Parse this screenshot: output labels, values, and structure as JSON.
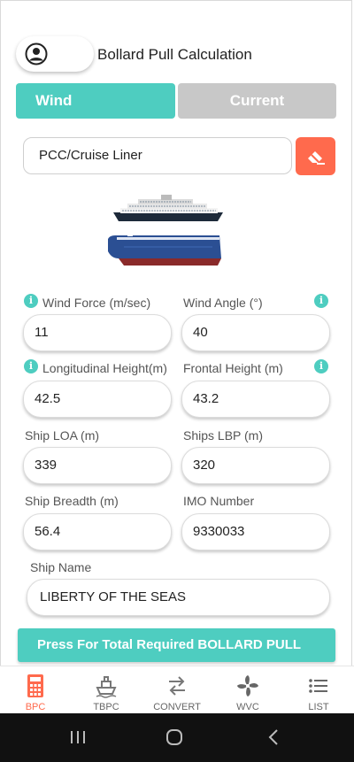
{
  "header": {
    "title": "Bollard Pull Calculation"
  },
  "tabs": [
    {
      "label": "Wind",
      "active": true
    },
    {
      "label": "Current",
      "active": false
    }
  ],
  "vessel_type": {
    "value": "PCC/Cruise Liner"
  },
  "fields": {
    "wind_force": {
      "label": "Wind Force (m/sec)",
      "value": "11"
    },
    "wind_angle": {
      "label": "Wind Angle (°)",
      "value": "40"
    },
    "long_height": {
      "label": "Longitudinal Height(m)",
      "value": "42.5"
    },
    "front_height": {
      "label": "Frontal Height (m)",
      "value": "43.2"
    },
    "ship_loa": {
      "label": "Ship LOA (m)",
      "value": "339"
    },
    "ships_lbp": {
      "label": "Ships LBP (m)",
      "value": "320"
    },
    "ship_breadth": {
      "label": "Ship Breadth (m)",
      "value": "56.4"
    },
    "imo_number": {
      "label": "IMO Number",
      "value": "9330033"
    },
    "ship_name": {
      "label": "Ship Name",
      "value": "LIBERTY OF THE SEAS"
    }
  },
  "action": {
    "label": "Press For Total Required BOLLARD PULL"
  },
  "nav": [
    {
      "label": "BPC",
      "icon": "calculator-icon",
      "active": true
    },
    {
      "label": "TBPC",
      "icon": "tug-icon",
      "active": false
    },
    {
      "label": "CONVERT",
      "icon": "swap-arrows-icon",
      "active": false
    },
    {
      "label": "WVC",
      "icon": "fan-icon",
      "active": false
    },
    {
      "label": "LIST",
      "icon": "list-icon",
      "active": false
    }
  ],
  "colors": {
    "accent": "#4ecdc0",
    "erase": "#ff6a4d",
    "inactive_tab": "#c8c8c8",
    "active_nav": "#ff6a4d"
  }
}
